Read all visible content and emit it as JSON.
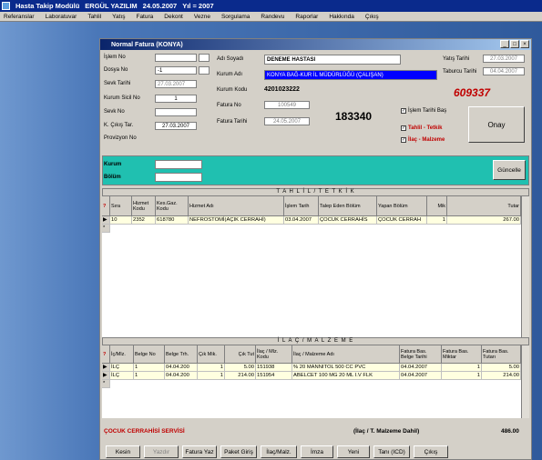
{
  "app": {
    "title": "Hasta Takip Modülü",
    "company": "ERGÜL YAZILIM",
    "date": "24.05.2007",
    "year": "Yıl = 2007"
  },
  "menu": [
    "Referanslar",
    "Laboratuvar",
    "Tahlil",
    "Yatış",
    "Fatura",
    "Dekont",
    "Vezne",
    "Sorgulama",
    "Randevu",
    "Raporlar",
    "Hakkında",
    "Çıkış"
  ],
  "window": {
    "title": "Normal Fatura (KONYA)"
  },
  "form": {
    "islem_no_label": "İşlem No",
    "dosya_no_label": "Dosya No",
    "dosya_no": "-1",
    "sevk_tarihi_label": "Sevk Tarihi",
    "sevk_tarihi": "27.03.2007",
    "kurum_sicil_label": "Kurum Sicil No",
    "kurum_sicil": "1",
    "sevk_no_label": "Sevk No",
    "k_cikis_label": "K. Çıkış Tar.",
    "k_cikis": "27.03.2007",
    "provizyon_label": "Provizyon No",
    "adi_soyadi_label": "Adı Soyadı",
    "adi_soyadi": "DENEME HASTASI",
    "kurum_adi_label": "Kurum Adı",
    "kurum_adi": "KONYA BAĞ-KUR İL MÜDÜRLÜĞÜ (ÇALIŞAN)",
    "kurum_kodu_label": "Kurum Kodu",
    "kurum_kodu": "4201023222",
    "fatura_no_label": "Fatura No",
    "fatura_no": "100549",
    "fatura_tarihi_label": "Fatura Tarihi",
    "fatura_tarihi": "24.05.2007",
    "big_number": "183340",
    "yatis_tarihi_label": "Yatış Tarihi",
    "yatis_tarihi": "27.03.2007",
    "taburcu_label": "Taburcu Tarihi",
    "taburcu": "04.04.2007",
    "red_number": "609337",
    "islem_tarihi_bas": "İşlem Tarihi Baş",
    "tahlil_tetkik": "Tahlil - Tetkik",
    "ilac_malzeme": "İlaç - Malzeme",
    "onay": "Onay",
    "kurum_label": "Kurum",
    "bolum_label": "Bölüm",
    "guncelle": "Güncelle"
  },
  "tahlil": {
    "section": "T A H L İ L  /  T E T K İ K",
    "headers": [
      "Sıra",
      "Hizmet Kodu",
      "Kes.Gaz. Kodu",
      "Hizmet Adı",
      "İşlem Tarih",
      "Talep Eden Bölüm",
      "Yapan Bölüm",
      "Mik",
      "Tutar"
    ],
    "rows": [
      [
        "10",
        "2352",
        "618780",
        "NEFROSTOMİ(AÇIK CERRAHİ)",
        "03.04.2007",
        "ÇOCUK CERRAHİS",
        "ÇOCUK CERRAH",
        "1",
        "267.00"
      ]
    ]
  },
  "ilac": {
    "section": "İ L A Ç  /  M A L Z E M E",
    "headers": [
      "İç/Mlz.",
      "Belge No",
      "Belge Trh.",
      "Çık Mik.",
      "Çık Tut",
      "İlaç / Mlz. Kodu",
      "İlaç / Malzeme Adı",
      "Fatura Bas. Belge Tarihi",
      "Fatura Bas. Miktar",
      "Fatura Bas. Tutarı"
    ],
    "rows": [
      [
        "İLÇ",
        "1",
        "04.04.200",
        "1",
        "5.00",
        "151938",
        "% 20 MANNITOL 500 CC PVC",
        "04.04.2007",
        "1",
        "5.00"
      ],
      [
        "İLÇ",
        "1",
        "04.04.200",
        "1",
        "214.00",
        "151954",
        "ABELCET 100 MG 20 ML I.V FLK",
        "04.04.2007",
        "1",
        "214.00"
      ]
    ]
  },
  "footer": {
    "service": "ÇOCUK CERRAHİSİ SERVİSİ",
    "note": "(İlaç / T. Malzeme Dahil)",
    "total": "486.00"
  },
  "buttons": [
    "Kesin",
    "Yazdır",
    "Fatura Yaz",
    "Paket Giriş",
    "İlaç/Malz.",
    "İmza",
    "Yeni",
    "Tanı (ICD)",
    "Çıkış"
  ]
}
